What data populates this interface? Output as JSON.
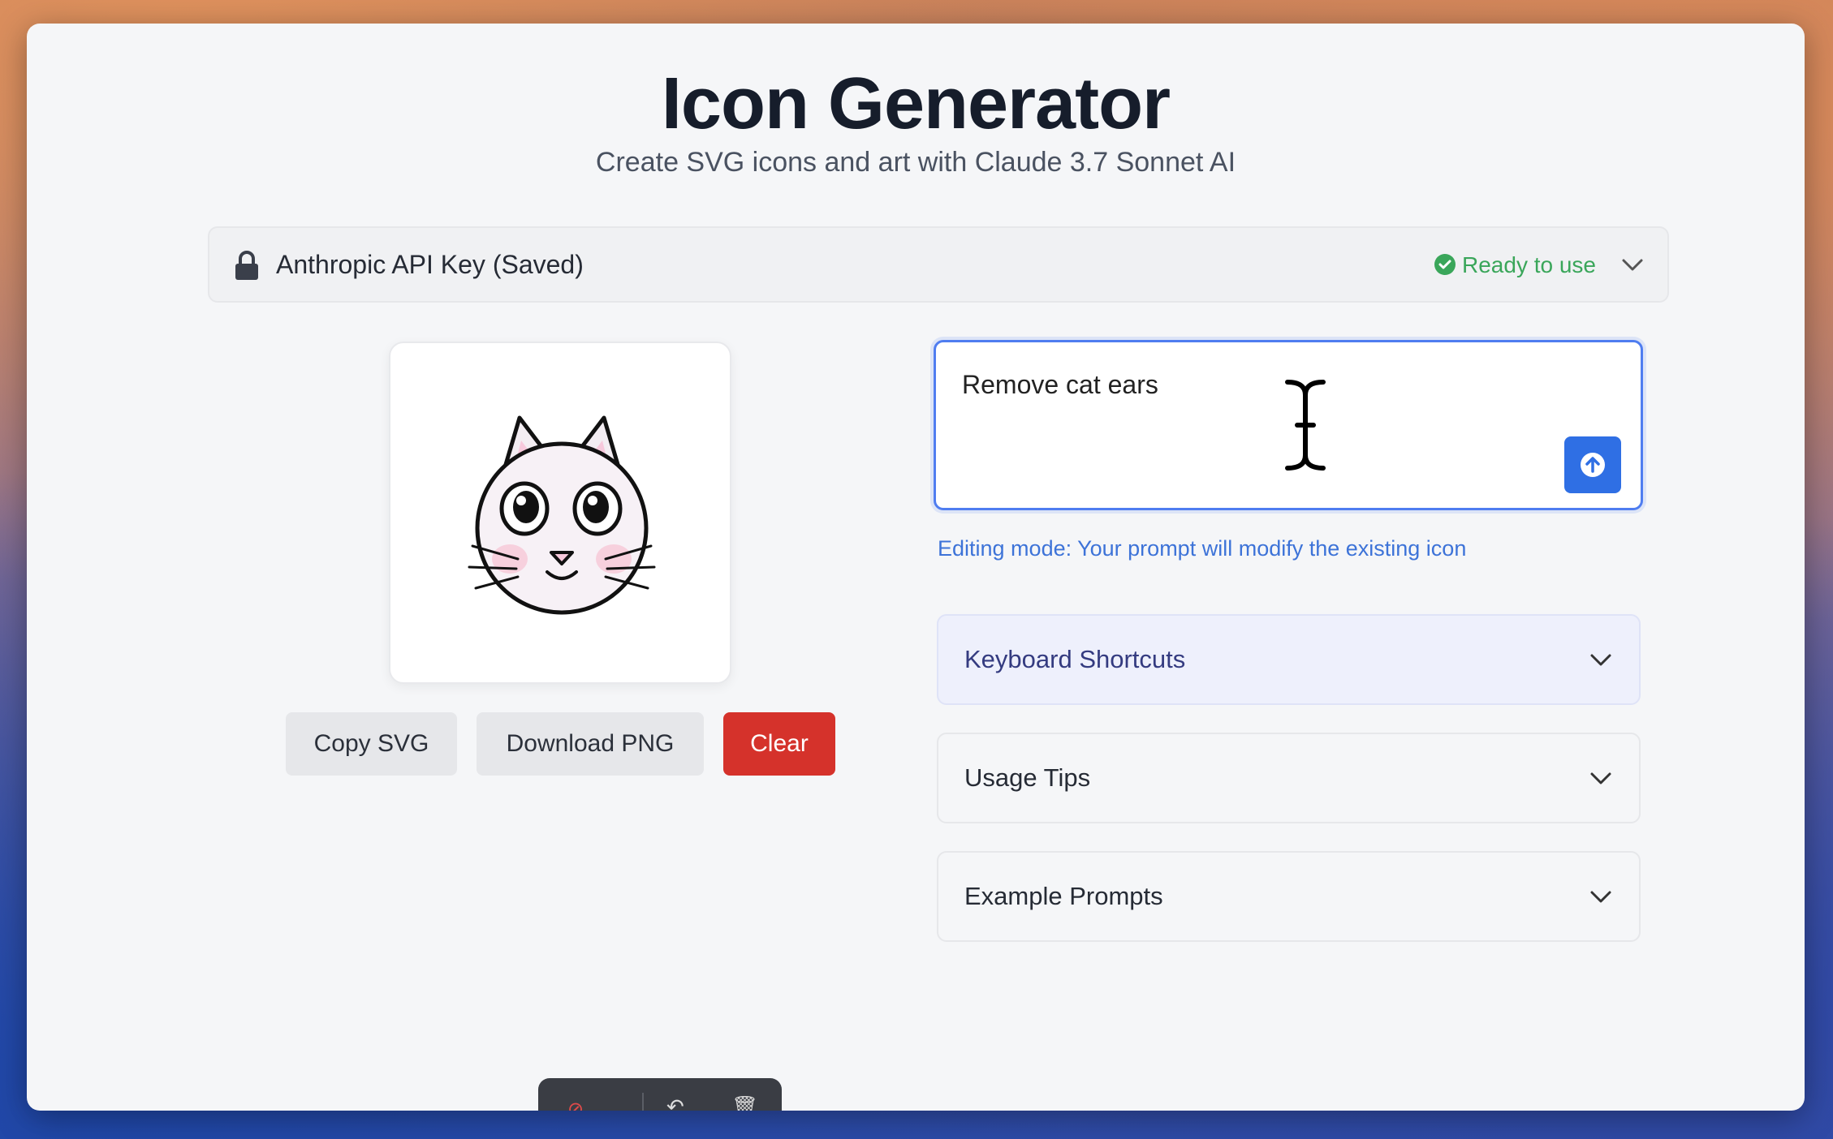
{
  "header": {
    "title": "Icon Generator",
    "subtitle": "Create SVG icons and art with Claude 3.7 Sonnet AI"
  },
  "api_key": {
    "label": "Anthropic API Key (Saved)",
    "status": "Ready to use",
    "icons": [
      "lock-icon",
      "check-circle-icon",
      "chevron-down-icon"
    ]
  },
  "actions": {
    "copy_svg": "Copy SVG",
    "download_png": "Download PNG",
    "clear": "Clear"
  },
  "prompt": {
    "value": "Remove cat ears",
    "hint": "Editing mode: Your prompt will modify the existing icon"
  },
  "panels": [
    {
      "label": "Keyboard Shortcuts"
    },
    {
      "label": "Usage Tips"
    },
    {
      "label": "Example Prompts"
    }
  ],
  "colors": {
    "accent": "#2f6fe4",
    "danger": "#d5322b",
    "success": "#3aa65a"
  }
}
